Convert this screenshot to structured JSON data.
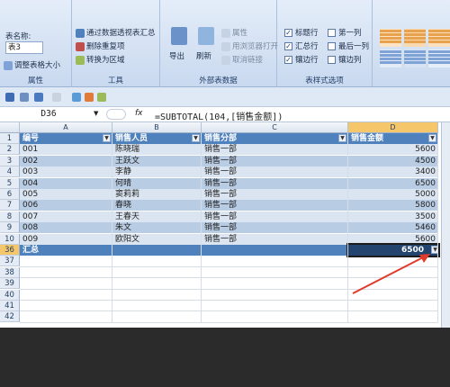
{
  "ribbon": {
    "props": {
      "label": "属性",
      "table_name_label": "表名称:",
      "table_name_value": "表3",
      "resize_label": "调整表格大小"
    },
    "tools": {
      "label": "工具",
      "pivot_label": "通过数据透视表汇总",
      "remove_dup_label": "删除重复项",
      "convert_label": "转换为区域"
    },
    "external": {
      "label": "外部表数据",
      "export_label": "导出",
      "refresh_label": "刷新",
      "properties_label": "属性",
      "open_browser_label": "用浏览器打开",
      "unlink_label": "取消链接"
    },
    "style_options": {
      "label": "表样式选项",
      "options": [
        {
          "label": "标题行",
          "checked": true
        },
        {
          "label": "第一列",
          "checked": false
        },
        {
          "label": "汇总行",
          "checked": true
        },
        {
          "label": "最后一列",
          "checked": false
        },
        {
          "label": "镶边行",
          "checked": true
        },
        {
          "label": "镶边列",
          "checked": false
        }
      ]
    }
  },
  "formula_bar": {
    "cell_ref": "D36",
    "fx": "fx",
    "formula": "=SUBTOTAL(104,[销售金额])"
  },
  "columns": [
    "A",
    "B",
    "C",
    "D"
  ],
  "table": {
    "headers": [
      "编号",
      "销售人员",
      "销售分部",
      "销售金额"
    ],
    "rows": [
      {
        "row": "2",
        "cells": [
          "001",
          "陈晓瑞",
          "销售一部",
          "5600"
        ]
      },
      {
        "row": "3",
        "cells": [
          "002",
          "王跃文",
          "销售一部",
          "4500"
        ]
      },
      {
        "row": "4",
        "cells": [
          "003",
          "李静",
          "销售一部",
          "3400"
        ]
      },
      {
        "row": "5",
        "cells": [
          "004",
          "何晴",
          "销售一部",
          "6500"
        ]
      },
      {
        "row": "6",
        "cells": [
          "005",
          "窦莉莉",
          "销售一部",
          "5000"
        ]
      },
      {
        "row": "7",
        "cells": [
          "006",
          "春晓",
          "销售一部",
          "5800"
        ]
      },
      {
        "row": "8",
        "cells": [
          "007",
          "王春天",
          "销售一部",
          "3500"
        ]
      },
      {
        "row": "9",
        "cells": [
          "008",
          "朱文",
          "销售一部",
          "5460"
        ]
      },
      {
        "row": "10",
        "cells": [
          "009",
          "欧阳文",
          "销售一部",
          "5600"
        ]
      }
    ],
    "total_row": {
      "row": "36",
      "label": "汇总",
      "value": "6500"
    },
    "empty_rows": [
      "37",
      "38",
      "39",
      "40",
      "41",
      "42"
    ],
    "header_row": "1"
  },
  "colors": {
    "table_header": "#4f81bd",
    "band_light": "#dbe5f1",
    "band_dark": "#b8cce4",
    "annotation_arrow": "#e23a2a"
  }
}
